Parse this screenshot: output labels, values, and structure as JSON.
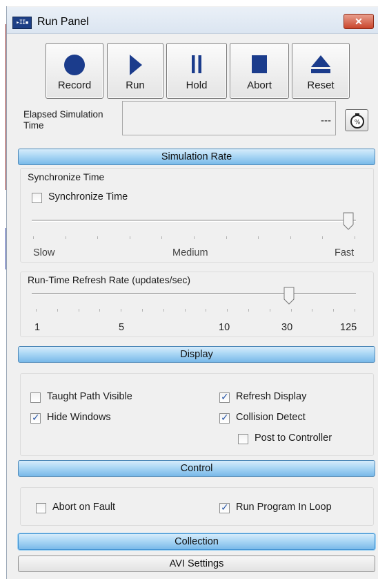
{
  "window": {
    "title": "Run Panel",
    "icon": "run-panel-app-icon",
    "close_glyph": "✕",
    "app_icon_text": "▸II▪"
  },
  "toolbar": {
    "buttons": [
      {
        "label": "Record",
        "icon": "record-icon"
      },
      {
        "label": "Run",
        "icon": "play-icon"
      },
      {
        "label": "Hold",
        "icon": "pause-icon"
      },
      {
        "label": "Abort",
        "icon": "stop-icon"
      },
      {
        "label": "Reset",
        "icon": "eject-icon"
      }
    ]
  },
  "elapsed": {
    "label": "Elapsed Simulation Time",
    "value": "---",
    "timer_icon": "stopwatch-icon"
  },
  "sections": {
    "simulation_rate": "Simulation Rate",
    "display": "Display",
    "control": "Control",
    "collection": "Collection",
    "avi": "AVI Settings"
  },
  "sync_group": {
    "title": "Synchronize Time",
    "checkbox": {
      "label": "Synchronize Time",
      "checked": false
    },
    "slider": {
      "min_label": "Slow",
      "mid_label": "Medium",
      "max_label": "Fast",
      "position_fraction": 1.0
    }
  },
  "refresh_group": {
    "title": "Run-Time Refresh Rate (updates/sec)",
    "slider": {
      "labels": [
        "1",
        "5",
        "10",
        "30",
        "125"
      ],
      "value": "30"
    }
  },
  "display_options": [
    {
      "label": "Taught Path Visible",
      "checked": false
    },
    {
      "label": "Refresh Display",
      "checked": true
    },
    {
      "label": "Hide Windows",
      "checked": true
    },
    {
      "label": "Collision Detect",
      "checked": true
    },
    {
      "label": "Post to Controller",
      "checked": false
    }
  ],
  "control_options": [
    {
      "label": "Abort on Fault",
      "checked": false
    },
    {
      "label": "Run Program In Loop",
      "checked": true
    }
  ],
  "colors": {
    "accent_blue": "#79b9e9",
    "icon_blue": "#1b3c8c",
    "close_red": "#c9452c"
  }
}
